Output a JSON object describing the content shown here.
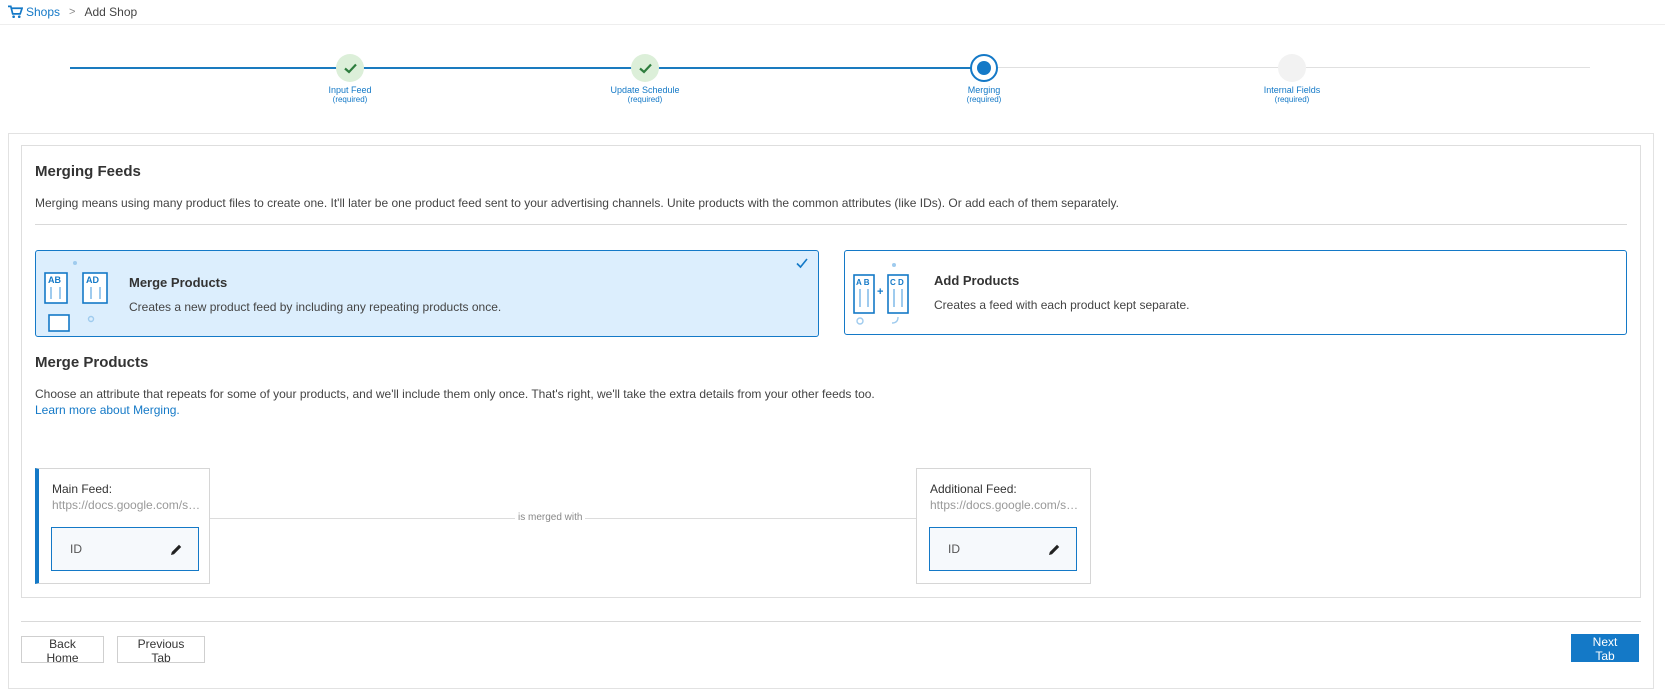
{
  "breadcrumb": {
    "root": "Shops",
    "separator": ">",
    "current": "Add Shop"
  },
  "stepper": {
    "steps": [
      {
        "label": "Input Feed",
        "sub": "(required)",
        "state": "done"
      },
      {
        "label": "Update Schedule",
        "sub": "(required)",
        "state": "done"
      },
      {
        "label": "Merging",
        "sub": "(required)",
        "state": "active"
      },
      {
        "label": "Internal Fields",
        "sub": "(required)",
        "state": "todo"
      }
    ]
  },
  "merging": {
    "title": "Merging Feeds",
    "description": "Merging means using many product files to create one. It'll later be one product feed sent to your advertising channels. Unite products with the common attributes (like IDs). Or add each of them separately."
  },
  "options": [
    {
      "title": "Merge Products",
      "description": "Creates a new product feed by including any repeating products once.",
      "selected": true,
      "icon_labels": [
        "AB",
        "AD"
      ]
    },
    {
      "title": "Add Products",
      "description": "Creates a feed with each product kept separate.",
      "selected": false,
      "icon_labels": [
        "A B",
        "C D"
      ]
    }
  ],
  "merge_section": {
    "title": "Merge Products",
    "description": "Choose an attribute that repeats for some of your products, and we'll include them only once. That's right, we'll take the extra details from your other feeds too.",
    "link": "Learn more about Merging."
  },
  "feeds": {
    "main": {
      "label": "Main Feed:",
      "url": "https://docs.google.com/spreadsheets",
      "attribute": "ID"
    },
    "additional": {
      "label": "Additional Feed:",
      "url": "https://docs.google.com/spreadsheets",
      "attribute": "ID"
    },
    "connector": "is merged with"
  },
  "footer": {
    "back_home": "Back Home",
    "previous_tab": "Previous Tab",
    "next_tab": "Next Tab"
  },
  "colors": {
    "accent": "#1479c7",
    "selected_bg": "#dceefd",
    "done_step": "#dcefd9"
  }
}
